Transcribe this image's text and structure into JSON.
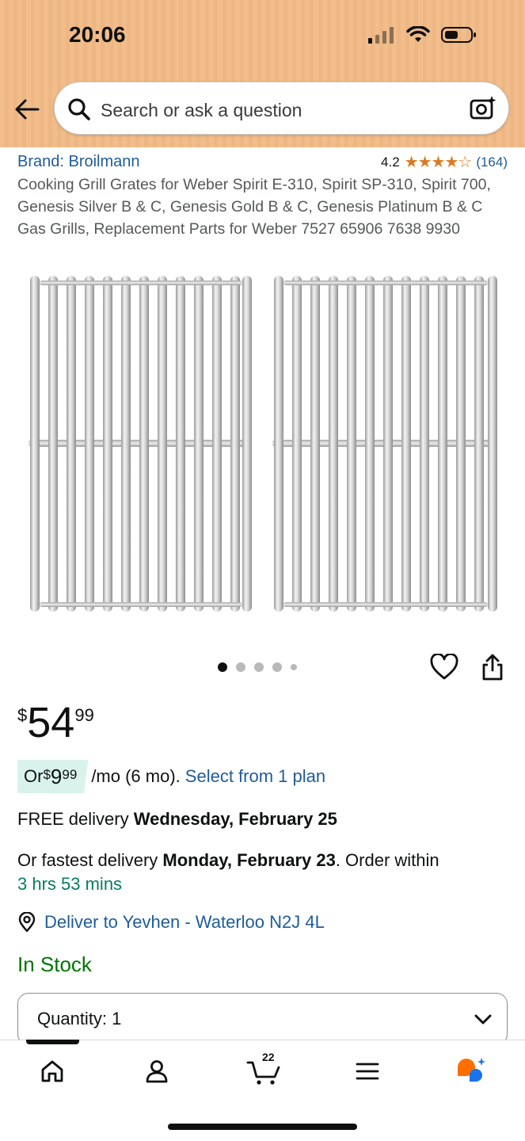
{
  "status_bar": {
    "time": "20:06"
  },
  "search": {
    "placeholder": "Search or ask a question"
  },
  "product": {
    "brand": "Brand: Broilmann",
    "rating_value": "4.2",
    "rating_stars": "★★★★☆",
    "rating_count": "(164)",
    "title": "Cooking Grill Grates for Weber Spirit E-310, Spirit SP-310, Spirit 700, Genesis Silver B & C, Genesis Gold B & C, Genesis Platinum B & C Gas Grills, Replacement Parts for Weber 7527 65906 7638 9930",
    "image_count": 5,
    "active_image": 1
  },
  "price": {
    "symbol": "$",
    "whole": "54",
    "fraction": "99"
  },
  "plan": {
    "prefix": "Or ",
    "symbol": "$",
    "whole": "9",
    "fraction": "99",
    "per": "/mo (6 mo).",
    "link": "Select from 1 plan"
  },
  "delivery": {
    "free_prefix": "FREE delivery ",
    "free_date": "Wednesday, February 25",
    "fastest_prefix": "Or fastest delivery ",
    "fastest_date": "Monday, February 23",
    "fastest_suffix": ". Order within",
    "countdown": "3 hrs 53 mins",
    "deliver_to": "Deliver to Yevhen - Waterloo N2J 4L"
  },
  "stock": "In Stock",
  "quantity": {
    "label": "Quantity:",
    "value": "1"
  },
  "tabbar": {
    "cart_count": "22"
  },
  "colors": {
    "link": "#1f5c99",
    "stock": "#007600",
    "countdown": "#067d62",
    "stars": "#de7921",
    "rufus": "#ff6f00"
  }
}
